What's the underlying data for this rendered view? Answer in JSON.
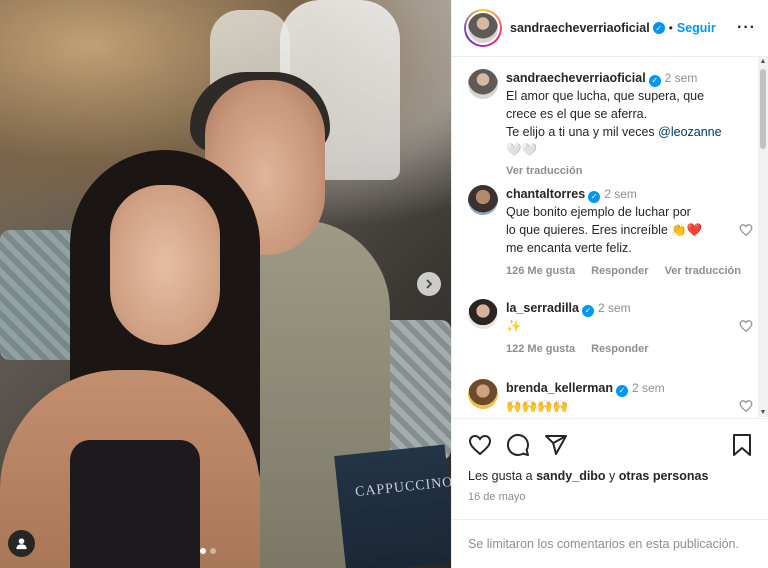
{
  "post": {
    "username": "sandraecheverriaoficial",
    "follow_label": "Seguir",
    "separator": "•",
    "more_icon": "···",
    "menu_text": "CAPPUCCINO"
  },
  "caption": {
    "username": "sandraecheverriaoficial",
    "time": "2 sem",
    "line1": "El amor que lucha, que supera, que",
    "line2": "crece es el que se aferra.",
    "line3_prefix": "Te elijo a ti una y mil veces ",
    "mention": "@leozanne",
    "line4": "🤍🤍",
    "translate": "Ver traducción"
  },
  "comments": [
    {
      "username": "chantaltorres",
      "time": "2 sem",
      "text_lines": [
        "Que bonito ejemplo de luchar por",
        "lo que quieres. Eres increíble 👏❤️",
        "me encanta verte feliz."
      ],
      "likes": "126 Me gusta",
      "reply": "Responder",
      "translate": "Ver traducción"
    },
    {
      "username": "la_serradilla",
      "time": "2 sem",
      "text_lines": [
        "✨"
      ],
      "likes": "122 Me gusta",
      "reply": "Responder"
    },
    {
      "username": "brenda_kellerman",
      "time": "2 sem",
      "text_lines": [
        "🙌🙌🙌🙌"
      ]
    }
  ],
  "actions": {
    "likes_prefix": "Les gusta a ",
    "likes_user": "sandy_dibo",
    "likes_mid": " y ",
    "likes_others": "otras personas",
    "date": "16 de mayo"
  },
  "footer": {
    "text": "Se limitaron los comentarios en esta publicación."
  },
  "colors": {
    "accent": "#0095f6",
    "muted": "#8e8e8e",
    "text": "#262626"
  }
}
